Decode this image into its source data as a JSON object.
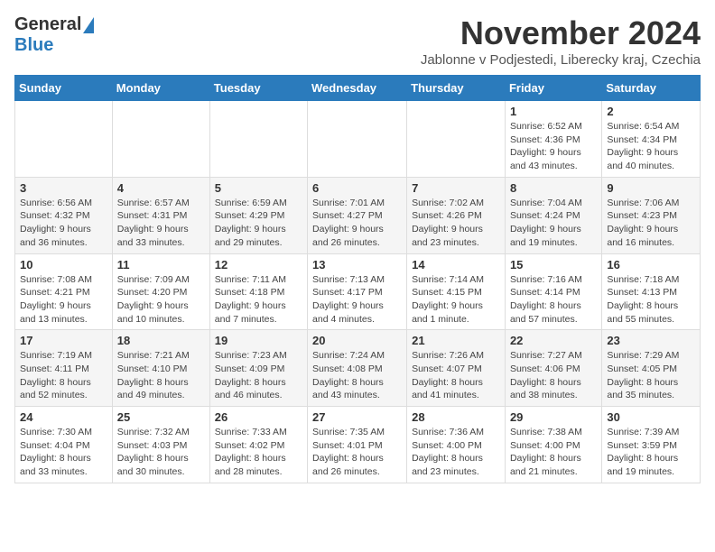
{
  "header": {
    "logo_general": "General",
    "logo_blue": "Blue",
    "month_title": "November 2024",
    "subtitle": "Jablonne v Podjestedi, Liberecky kraj, Czechia"
  },
  "weekdays": [
    "Sunday",
    "Monday",
    "Tuesday",
    "Wednesday",
    "Thursday",
    "Friday",
    "Saturday"
  ],
  "weeks": [
    [
      {
        "day": "",
        "info": ""
      },
      {
        "day": "",
        "info": ""
      },
      {
        "day": "",
        "info": ""
      },
      {
        "day": "",
        "info": ""
      },
      {
        "day": "",
        "info": ""
      },
      {
        "day": "1",
        "info": "Sunrise: 6:52 AM\nSunset: 4:36 PM\nDaylight: 9 hours\nand 43 minutes."
      },
      {
        "day": "2",
        "info": "Sunrise: 6:54 AM\nSunset: 4:34 PM\nDaylight: 9 hours\nand 40 minutes."
      }
    ],
    [
      {
        "day": "3",
        "info": "Sunrise: 6:56 AM\nSunset: 4:32 PM\nDaylight: 9 hours\nand 36 minutes."
      },
      {
        "day": "4",
        "info": "Sunrise: 6:57 AM\nSunset: 4:31 PM\nDaylight: 9 hours\nand 33 minutes."
      },
      {
        "day": "5",
        "info": "Sunrise: 6:59 AM\nSunset: 4:29 PM\nDaylight: 9 hours\nand 29 minutes."
      },
      {
        "day": "6",
        "info": "Sunrise: 7:01 AM\nSunset: 4:27 PM\nDaylight: 9 hours\nand 26 minutes."
      },
      {
        "day": "7",
        "info": "Sunrise: 7:02 AM\nSunset: 4:26 PM\nDaylight: 9 hours\nand 23 minutes."
      },
      {
        "day": "8",
        "info": "Sunrise: 7:04 AM\nSunset: 4:24 PM\nDaylight: 9 hours\nand 19 minutes."
      },
      {
        "day": "9",
        "info": "Sunrise: 7:06 AM\nSunset: 4:23 PM\nDaylight: 9 hours\nand 16 minutes."
      }
    ],
    [
      {
        "day": "10",
        "info": "Sunrise: 7:08 AM\nSunset: 4:21 PM\nDaylight: 9 hours\nand 13 minutes."
      },
      {
        "day": "11",
        "info": "Sunrise: 7:09 AM\nSunset: 4:20 PM\nDaylight: 9 hours\nand 10 minutes."
      },
      {
        "day": "12",
        "info": "Sunrise: 7:11 AM\nSunset: 4:18 PM\nDaylight: 9 hours\nand 7 minutes."
      },
      {
        "day": "13",
        "info": "Sunrise: 7:13 AM\nSunset: 4:17 PM\nDaylight: 9 hours\nand 4 minutes."
      },
      {
        "day": "14",
        "info": "Sunrise: 7:14 AM\nSunset: 4:15 PM\nDaylight: 9 hours\nand 1 minute."
      },
      {
        "day": "15",
        "info": "Sunrise: 7:16 AM\nSunset: 4:14 PM\nDaylight: 8 hours\nand 57 minutes."
      },
      {
        "day": "16",
        "info": "Sunrise: 7:18 AM\nSunset: 4:13 PM\nDaylight: 8 hours\nand 55 minutes."
      }
    ],
    [
      {
        "day": "17",
        "info": "Sunrise: 7:19 AM\nSunset: 4:11 PM\nDaylight: 8 hours\nand 52 minutes."
      },
      {
        "day": "18",
        "info": "Sunrise: 7:21 AM\nSunset: 4:10 PM\nDaylight: 8 hours\nand 49 minutes."
      },
      {
        "day": "19",
        "info": "Sunrise: 7:23 AM\nSunset: 4:09 PM\nDaylight: 8 hours\nand 46 minutes."
      },
      {
        "day": "20",
        "info": "Sunrise: 7:24 AM\nSunset: 4:08 PM\nDaylight: 8 hours\nand 43 minutes."
      },
      {
        "day": "21",
        "info": "Sunrise: 7:26 AM\nSunset: 4:07 PM\nDaylight: 8 hours\nand 41 minutes."
      },
      {
        "day": "22",
        "info": "Sunrise: 7:27 AM\nSunset: 4:06 PM\nDaylight: 8 hours\nand 38 minutes."
      },
      {
        "day": "23",
        "info": "Sunrise: 7:29 AM\nSunset: 4:05 PM\nDaylight: 8 hours\nand 35 minutes."
      }
    ],
    [
      {
        "day": "24",
        "info": "Sunrise: 7:30 AM\nSunset: 4:04 PM\nDaylight: 8 hours\nand 33 minutes."
      },
      {
        "day": "25",
        "info": "Sunrise: 7:32 AM\nSunset: 4:03 PM\nDaylight: 8 hours\nand 30 minutes."
      },
      {
        "day": "26",
        "info": "Sunrise: 7:33 AM\nSunset: 4:02 PM\nDaylight: 8 hours\nand 28 minutes."
      },
      {
        "day": "27",
        "info": "Sunrise: 7:35 AM\nSunset: 4:01 PM\nDaylight: 8 hours\nand 26 minutes."
      },
      {
        "day": "28",
        "info": "Sunrise: 7:36 AM\nSunset: 4:00 PM\nDaylight: 8 hours\nand 23 minutes."
      },
      {
        "day": "29",
        "info": "Sunrise: 7:38 AM\nSunset: 4:00 PM\nDaylight: 8 hours\nand 21 minutes."
      },
      {
        "day": "30",
        "info": "Sunrise: 7:39 AM\nSunset: 3:59 PM\nDaylight: 8 hours\nand 19 minutes."
      }
    ]
  ]
}
